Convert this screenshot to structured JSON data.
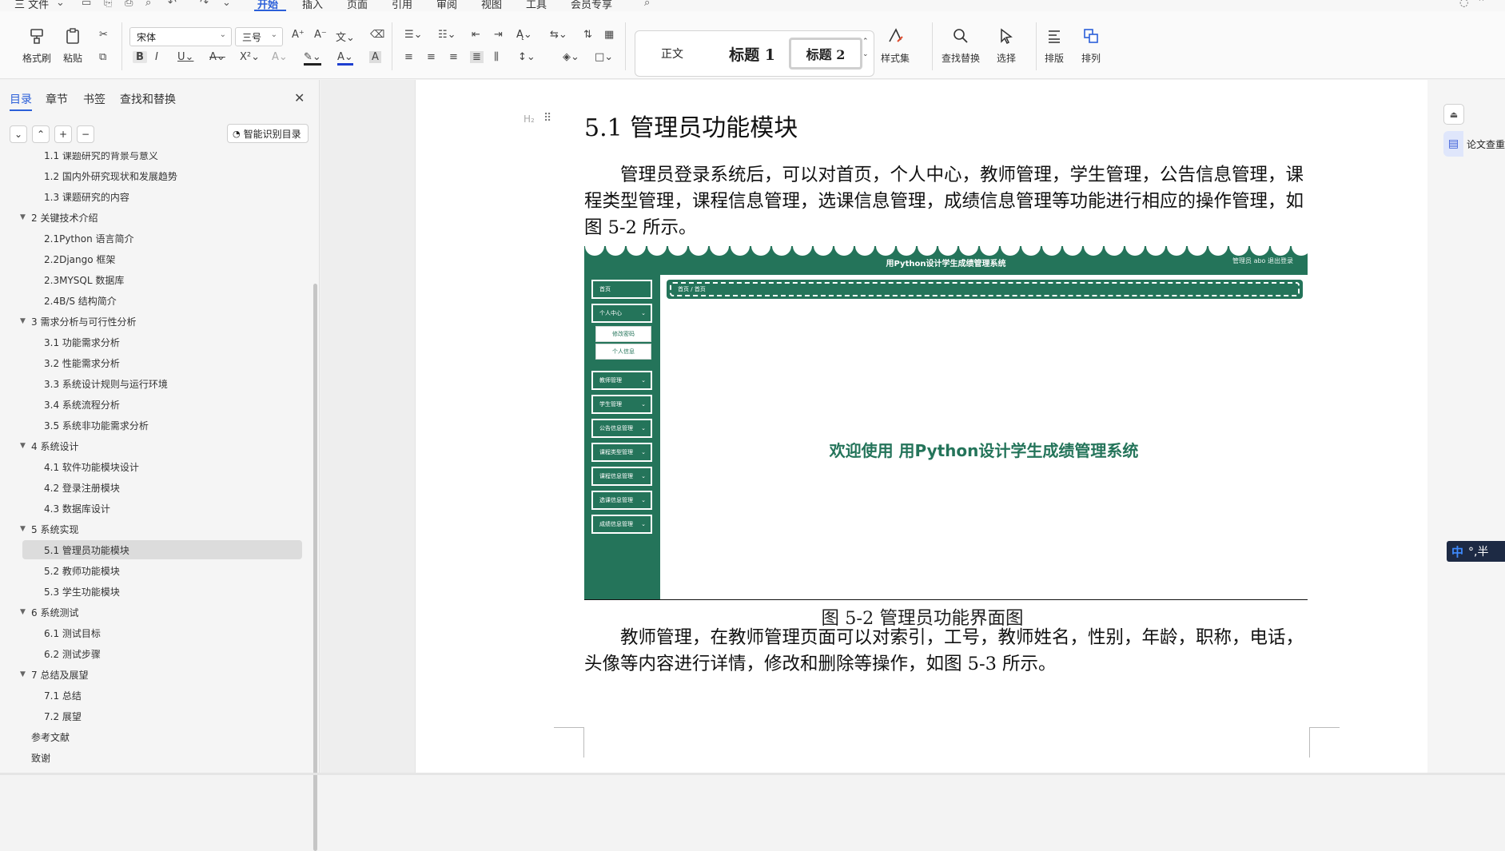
{
  "menubar": {
    "file": "三 文件",
    "tabs": [
      "开始",
      "插入",
      "页面",
      "引用",
      "审阅",
      "视图",
      "工具",
      "会员专享"
    ],
    "active_tab": "开始"
  },
  "ribbon": {
    "format_painter": "格式刷",
    "paste": "粘贴",
    "font_name": "宋体",
    "font_size": "三号",
    "styles": [
      "正文",
      "标题 1",
      "标题 2"
    ],
    "style_set": "样式集",
    "find_replace": "查找替换",
    "select": "选择",
    "layout": "排版",
    "arrange": "排列"
  },
  "nav": {
    "tabs": [
      "目录",
      "章节",
      "书签",
      "查找和替换"
    ],
    "active_tab": "目录",
    "smart_toc": "智能识别目录",
    "items": [
      {
        "label": "1.1 课题研究的背景与意义",
        "level": 2
      },
      {
        "label": "1.2 国内外研究现状和发展趋势",
        "level": 2
      },
      {
        "label": "1.3 课题研究的内容",
        "level": 2
      },
      {
        "label": "2 关键技术介绍",
        "level": 1
      },
      {
        "label": "2.1Python 语言简介",
        "level": 2
      },
      {
        "label": "2.2Django 框架",
        "level": 2
      },
      {
        "label": "2.3MYSQL 数据库",
        "level": 2
      },
      {
        "label": "2.4B/S 结构简介",
        "level": 2
      },
      {
        "label": "3 需求分析与可行性分析",
        "level": 1
      },
      {
        "label": "3.1 功能需求分析",
        "level": 2
      },
      {
        "label": "3.2 性能需求分析",
        "level": 2
      },
      {
        "label": "3.3 系统设计规则与运行环境",
        "level": 2
      },
      {
        "label": "3.4 系统流程分析",
        "level": 2
      },
      {
        "label": "3.5 系统非功能需求分析",
        "level": 2
      },
      {
        "label": "4 系统设计",
        "level": 1
      },
      {
        "label": "4.1 软件功能模块设计",
        "level": 2
      },
      {
        "label": "4.2 登录注册模块",
        "level": 2
      },
      {
        "label": "4.3 数据库设计",
        "level": 2
      },
      {
        "label": "5 系统实现",
        "level": 1
      },
      {
        "label": "5.1 管理员功能模块",
        "level": 2,
        "selected": true
      },
      {
        "label": "5.2 教师功能模块",
        "level": 2
      },
      {
        "label": "5.3 学生功能模块",
        "level": 2
      },
      {
        "label": "6 系统测试",
        "level": 1
      },
      {
        "label": "6.1 测试目标",
        "level": 2
      },
      {
        "label": "6.2 测试步骤",
        "level": 2
      },
      {
        "label": "7 总结及展望",
        "level": 1
      },
      {
        "label": "7.1 总结",
        "level": 2
      },
      {
        "label": "7.2 展望",
        "level": 2
      },
      {
        "label": "参考文献",
        "level": 0
      },
      {
        "label": "致谢",
        "level": 0
      }
    ]
  },
  "document": {
    "heading": "5.1 管理员功能模块",
    "paragraph1": "管理员登录系统后，可以对首页，个人中心，教师管理，学生管理，公告信息管理，课程类型管理，课程信息管理，选课信息管理，成绩信息管理等功能进行相应的操作管理，如图 5-2 所示。",
    "caption": "图 5-2 管理员功能界面图",
    "paragraph2": "教师管理，在教师管理页面可以对索引，工号，教师姓名，性别，年龄，职称，电话，头像等内容进行详情，修改和删除等操作，如图 5-3 所示。"
  },
  "figure": {
    "app_title": "用Python设计学生成绩管理系统",
    "user_info": "管理员 abo  退出登录",
    "breadcrumb": "首页 / 首页",
    "menu": [
      "首页",
      "个人中心",
      "教师管理",
      "学生管理",
      "公告信息管理",
      "课程类型管理",
      "课程信息管理",
      "选课信息管理",
      "成绩信息管理"
    ],
    "submenu": [
      "修改密码",
      "个人信息"
    ],
    "welcome": "欢迎使用 用Python设计学生成绩管理系统",
    "theme_color": "#24745a"
  },
  "rightpanel": {
    "paper_check": "论文查重",
    "ime": "中",
    "ime_extra": "°,半"
  },
  "colors": {
    "accent": "#2b5fd9",
    "figure_green": "#24745a"
  }
}
